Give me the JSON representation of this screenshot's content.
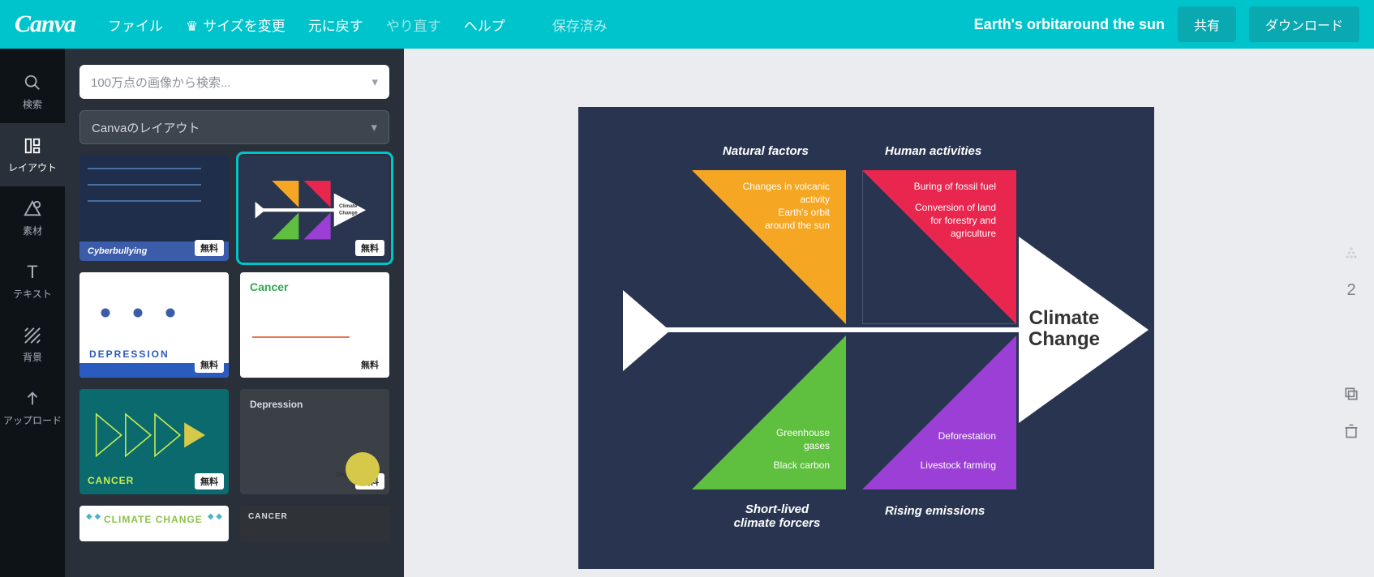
{
  "topbar": {
    "logo": "Canva",
    "menu": {
      "file": "ファイル",
      "resize": "サイズを変更",
      "undo": "元に戻す",
      "redo": "やり直す",
      "help": "ヘルプ",
      "saved": "保存済み"
    },
    "doc_title": "Earth's orbitaround the sun",
    "share": "共有",
    "download": "ダウンロード"
  },
  "rail": {
    "search": "検索",
    "layout": "レイアウト",
    "elements": "素材",
    "text": "テキスト",
    "background": "背景",
    "upload": "アップロード"
  },
  "panel": {
    "search_placeholder": "100万点の画像から検索...",
    "layout_select": "Canvaのレイアウト",
    "badge": "無料",
    "templates": {
      "t1": "Cyberbullying",
      "t3": "DEPRESSION",
      "t4": "Cancer",
      "t5": "CANCER",
      "t6": "Depression",
      "t6b": "Depression",
      "t7": "CLIMATE CHANGE",
      "t8": "CANCER"
    }
  },
  "canvas": {
    "natural_factors": "Natural factors",
    "human_activities": "Human activities",
    "short_lived": "Short-lived climate forcers",
    "rising_emissions": "Rising emissions",
    "climate_change_1": "Climate",
    "climate_change_2": "Change",
    "tri_orange_1": "Changes in volcanic activity",
    "tri_orange_2": "Earth's orbit around the sun",
    "tri_red_1": "Buring of fossil fuel",
    "tri_red_2": "Conversion of land for forestry and agriculture",
    "tri_green_1": "Greenhouse gases",
    "tri_green_2": "Black carbon",
    "tri_purple_1": "Deforestation",
    "tri_purple_2": "Livestock farming"
  },
  "right_tools": {
    "page_num": "2"
  }
}
